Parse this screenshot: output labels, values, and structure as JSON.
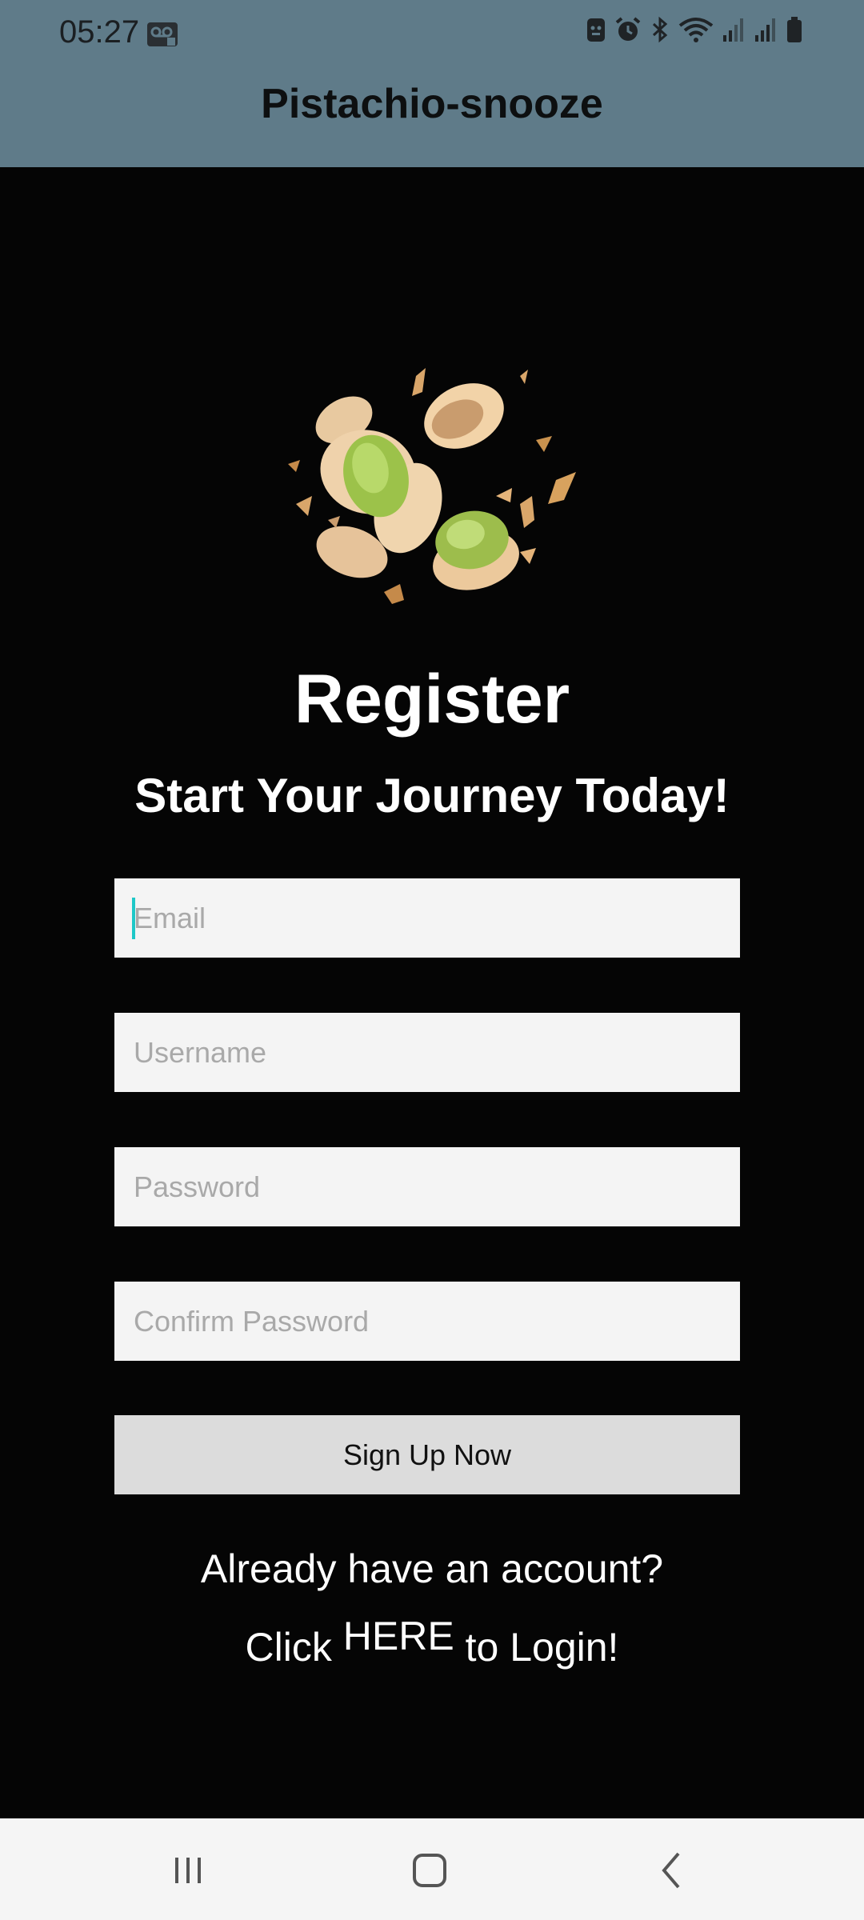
{
  "status_bar": {
    "time": "05:27"
  },
  "app_bar": {
    "title": "Pistachio-snooze"
  },
  "register": {
    "heading": "Register",
    "subheading": "Start Your Journey Today!",
    "email_placeholder": "Email",
    "username_placeholder": "Username",
    "password_placeholder": "Password",
    "confirm_placeholder": "Confirm Password",
    "signup_label": "Sign Up Now",
    "already_text": "Already have an account?",
    "login_prefix": "Click",
    "login_link": "HERE",
    "login_suffix": "to Login!"
  },
  "colors": {
    "app_bar": "#5f7b89",
    "background": "#050505",
    "field": "#f4f4f4",
    "button": "#dcdcdc",
    "cursor": "#1ec8c8"
  }
}
